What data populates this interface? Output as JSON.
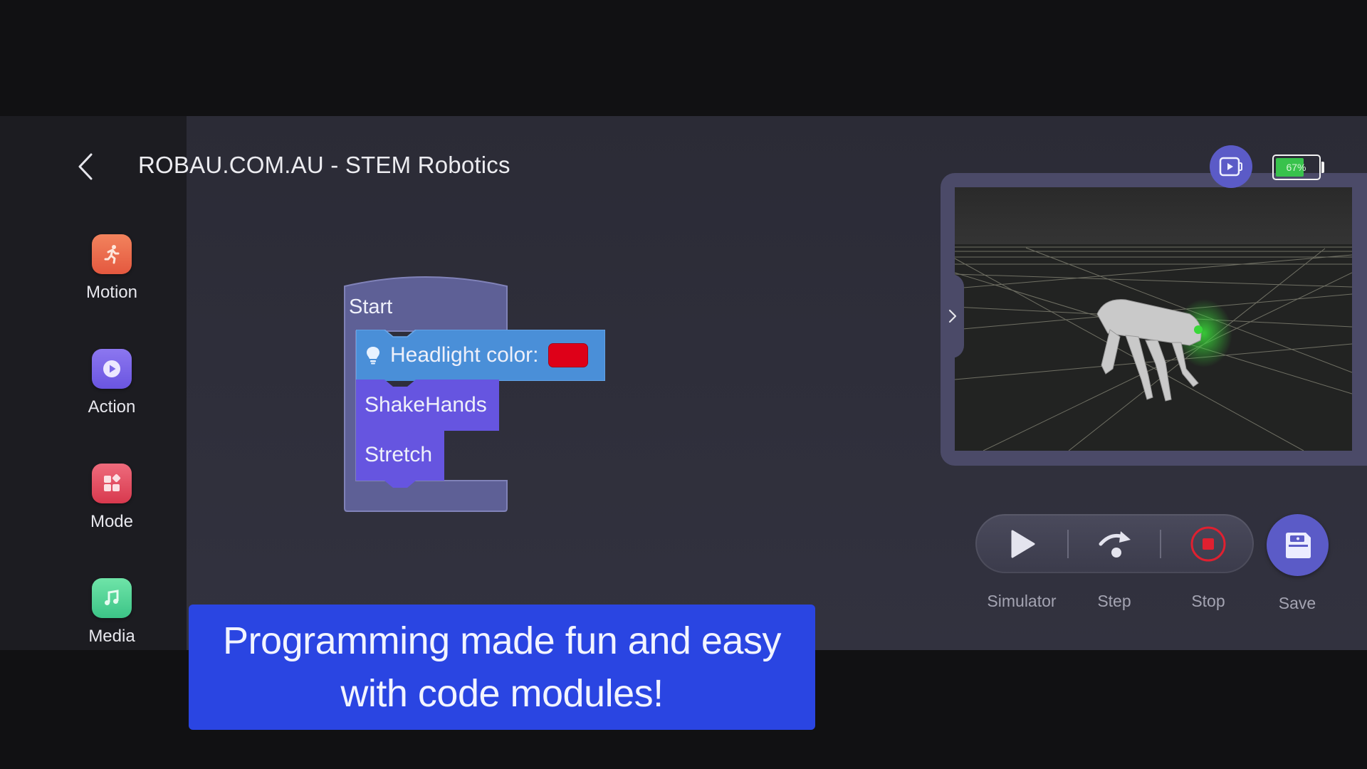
{
  "header": {
    "title": "ROBAU.COM.AU - STEM Robotics",
    "back_icon": "chevron-left-icon"
  },
  "sidebar": {
    "items": [
      {
        "label": "Motion",
        "icon": "running-person-icon",
        "color": "#ec6a4b"
      },
      {
        "label": "Action",
        "icon": "play-circle-icon",
        "color": "#7a66e8"
      },
      {
        "label": "Mode",
        "icon": "grid-icon",
        "color": "#e25062"
      },
      {
        "label": "Media",
        "icon": "music-note-icon",
        "color": "#52d497"
      }
    ]
  },
  "program": {
    "start_label": "Start",
    "blocks": [
      {
        "label": "Headlight color:",
        "icon": "lightbulb-icon",
        "value_color": "#de0018",
        "color": "#4a8fd8"
      },
      {
        "label": "ShakeHands",
        "color": "#6655e0"
      },
      {
        "label": "Stretch",
        "color": "#6655e0"
      }
    ]
  },
  "status": {
    "battery_percent": 67,
    "battery_label": "67%",
    "record_icon": "screen-record-icon"
  },
  "simulator": {
    "toggle_icon": "chevron-right-icon",
    "headlight_glow": "#3ad83a"
  },
  "controls": {
    "simulator_label": "Simulator",
    "step_label": "Step",
    "stop_label": "Stop",
    "save_label": "Save",
    "stop_color": "#e02030",
    "accent": "#5b5bc7"
  },
  "caption": {
    "line1": "Programming made fun and easy",
    "line2": "with code modules!"
  }
}
